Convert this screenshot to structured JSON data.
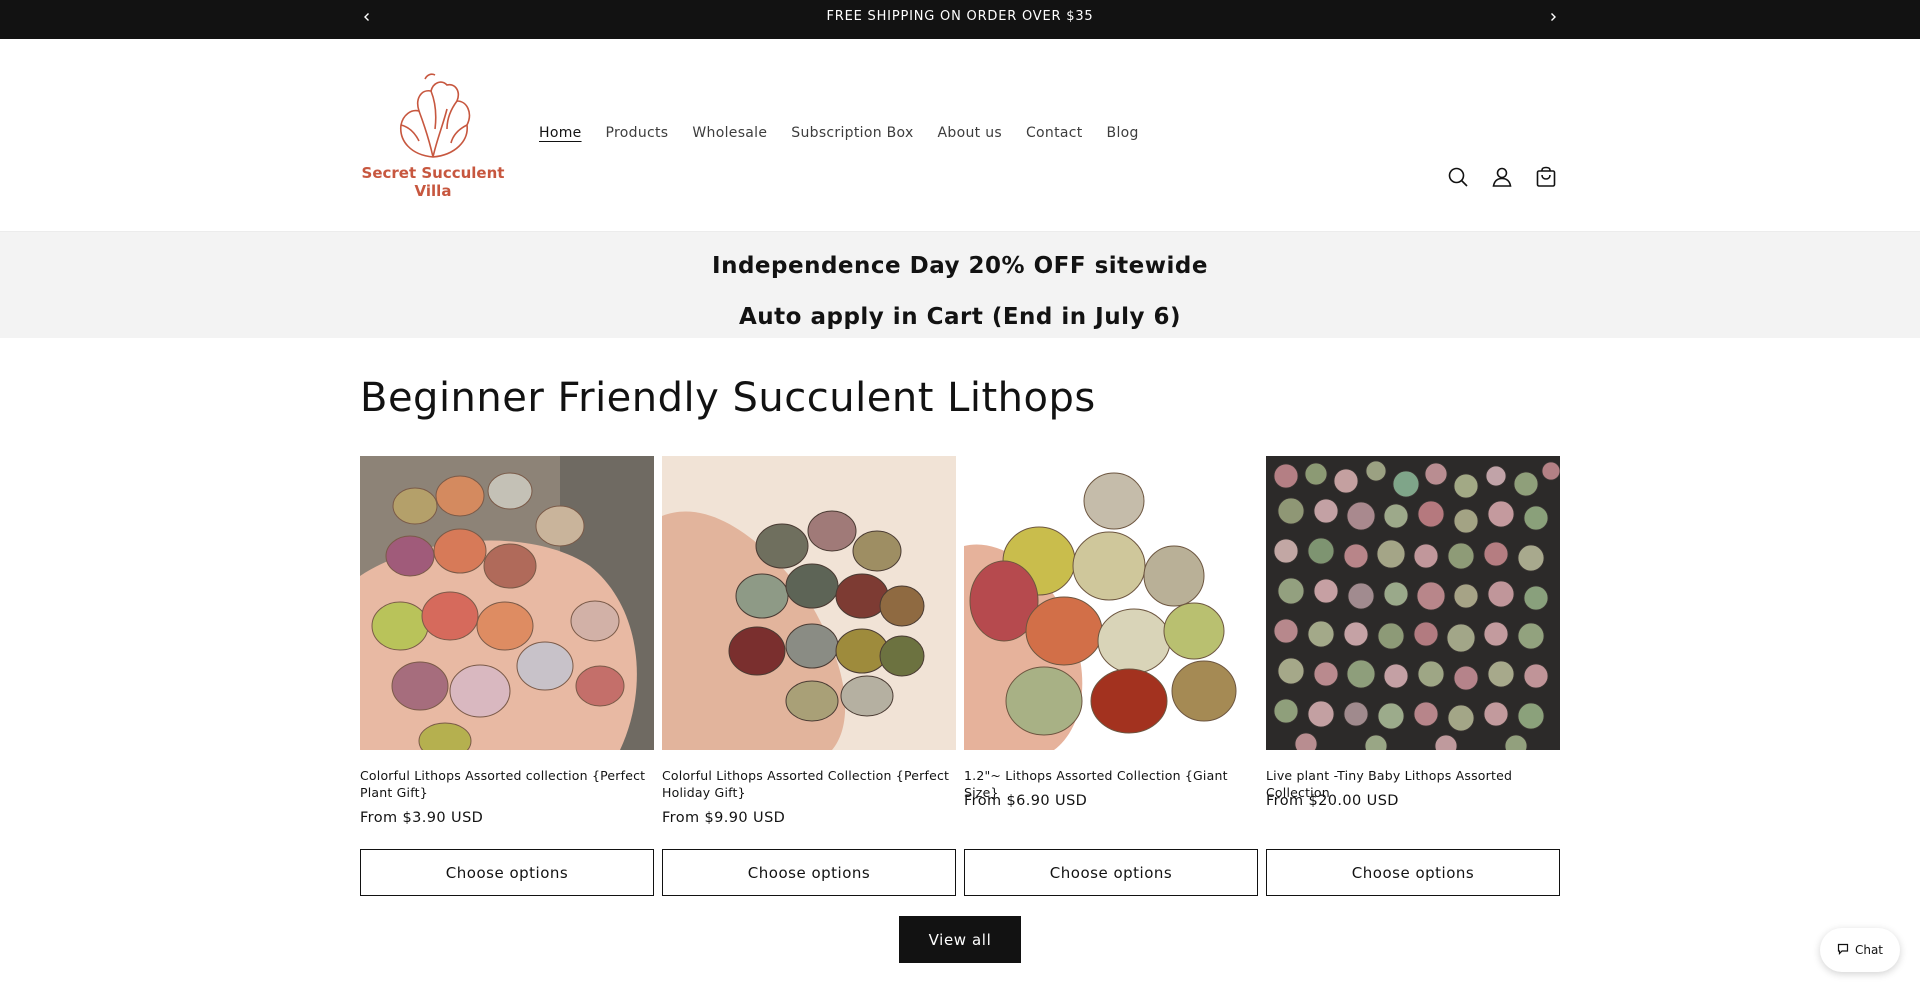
{
  "announcement": {
    "text": "FREE SHIPPING ON ORDER OVER $35",
    "prev_icon": "chevron-left-icon",
    "next_icon": "chevron-right-icon"
  },
  "header": {
    "logo_line1": "Secret Succulent",
    "logo_line2": "Villa",
    "logo_color": "#c7573f",
    "nav": [
      {
        "label": "Home",
        "active": true
      },
      {
        "label": "Products"
      },
      {
        "label": "Wholesale"
      },
      {
        "label": "Subscription Box"
      },
      {
        "label": "About us"
      },
      {
        "label": "Contact"
      },
      {
        "label": "Blog"
      }
    ],
    "icons": [
      "search-icon",
      "account-icon",
      "cart-icon"
    ]
  },
  "promo": {
    "line1": "Independence Day 20% OFF sitewide",
    "line2": "Auto apply in Cart (End in July 6)"
  },
  "collection": {
    "title": "Beginner Friendly Succulent Lithops",
    "products": [
      {
        "title": "Colorful Lithops Assorted collection {Perfect Plant Gift}",
        "price": "From $3.90 USD",
        "button": "Choose options"
      },
      {
        "title": "Colorful Lithops Assorted Collection {Perfect Holiday Gift}",
        "price": "From $9.90 USD",
        "button": "Choose options"
      },
      {
        "title": "1.2\"~ Lithops Assorted Collection {Giant Size}",
        "price": "From $6.90 USD",
        "button": "Choose options"
      },
      {
        "title": "Live plant -Tiny Baby Lithops Assorted Collection",
        "price": "From $20.00 USD",
        "button": "Choose options"
      }
    ],
    "view_all": "View all"
  },
  "chat": {
    "label": "Chat",
    "icon": "chat-bubble-icon"
  },
  "colors": {
    "dark": "#121212",
    "promo_bg": "#f3f3f3",
    "brand": "#c7573f"
  }
}
